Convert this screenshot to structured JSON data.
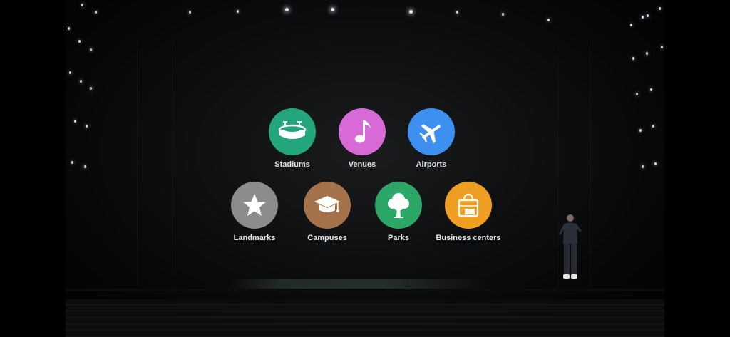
{
  "categories": {
    "stadiums": {
      "label": "Stadiums",
      "color": "#23a67c",
      "icon": "stadium-icon"
    },
    "venues": {
      "label": "Venues",
      "color": "#d76ad6",
      "icon": "music-note-icon"
    },
    "airports": {
      "label": "Airports",
      "color": "#3d8ff0",
      "icon": "airplane-icon"
    },
    "landmarks": {
      "label": "Landmarks",
      "color": "#8c8c8e",
      "icon": "star-icon"
    },
    "campuses": {
      "label": "Campuses",
      "color": "#a4734c",
      "icon": "graduation-cap-icon"
    },
    "parks": {
      "label": "Parks",
      "color": "#2ba868",
      "icon": "tree-icon"
    },
    "business_centers": {
      "label": "Business centers",
      "color": "#ee9f22",
      "icon": "shopping-bag-icon"
    }
  }
}
